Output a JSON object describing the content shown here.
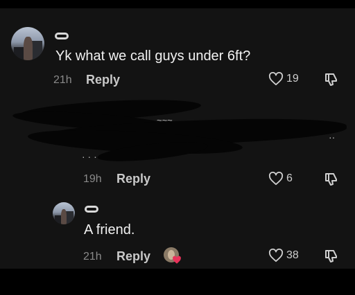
{
  "thread": {
    "comment1": {
      "text": "Yk what we call guys under 6ft?",
      "time": "21h",
      "reply_label": "Reply",
      "likes": "19"
    },
    "comment2": {
      "time": "19h",
      "reply_label": "Reply",
      "likes": "6"
    },
    "reply1": {
      "text": "A friend.",
      "time": "21h",
      "reply_label": "Reply",
      "likes": "38"
    }
  },
  "colors": {
    "screen_bg": "#131313",
    "letterbox": "#000000",
    "heart_badge": "#e8325a"
  },
  "icons": [
    "visor-badge-icon",
    "heart-outline-icon",
    "thumbs-down-icon",
    "creator-liked-icon"
  ]
}
